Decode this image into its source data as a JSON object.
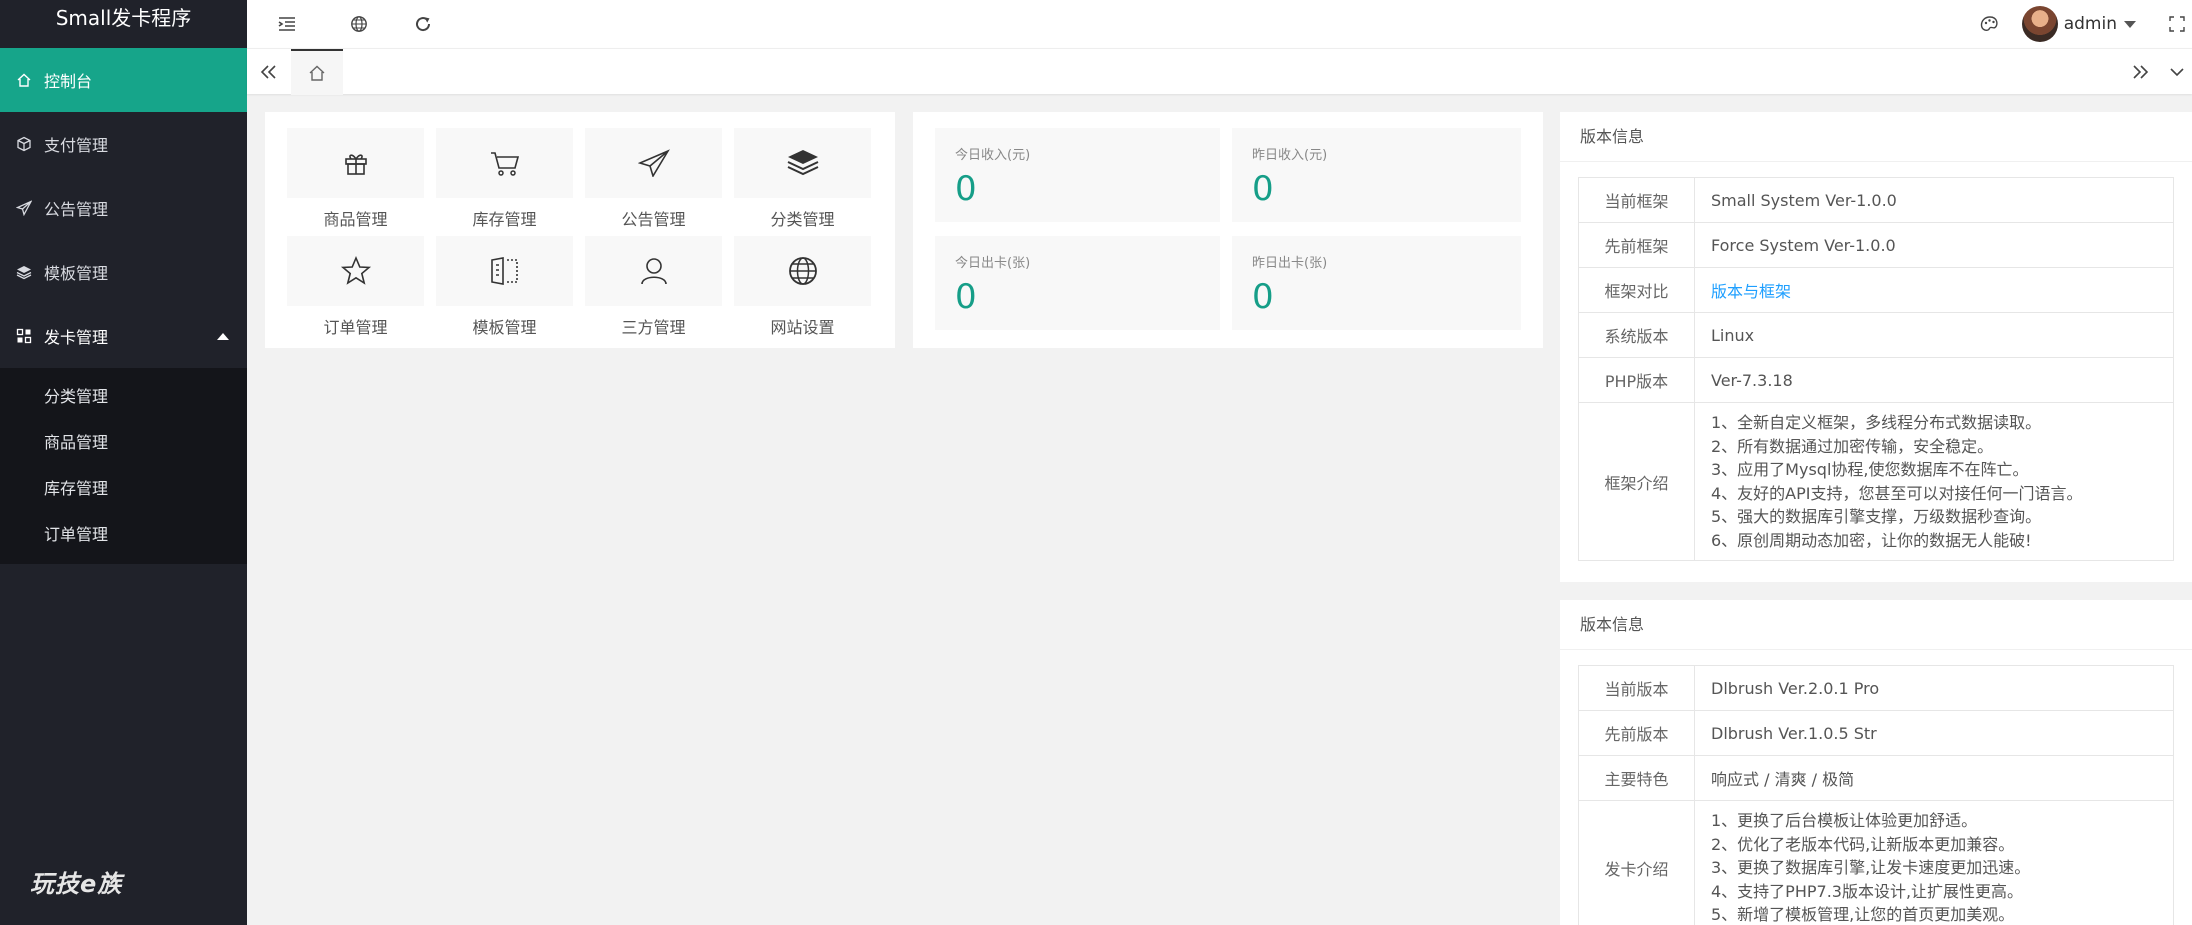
{
  "app": {
    "title": "Small发卡程序"
  },
  "sidebar": {
    "items": [
      {
        "label": "控制台"
      },
      {
        "label": "支付管理"
      },
      {
        "label": "公告管理"
      },
      {
        "label": "模板管理"
      },
      {
        "label": "发卡管理"
      }
    ],
    "subitems": [
      {
        "label": "分类管理"
      },
      {
        "label": "商品管理"
      },
      {
        "label": "库存管理"
      },
      {
        "label": "订单管理"
      }
    ],
    "brand": "玩技e族"
  },
  "header": {
    "user": "admin"
  },
  "quick": [
    {
      "label": "商品管理",
      "icon": "gift-icon"
    },
    {
      "label": "库存管理",
      "icon": "cart-icon"
    },
    {
      "label": "公告管理",
      "icon": "paper-plane-icon"
    },
    {
      "label": "分类管理",
      "icon": "layers-icon"
    },
    {
      "label": "订单管理",
      "icon": "star-icon"
    },
    {
      "label": "模板管理",
      "icon": "template-icon"
    },
    {
      "label": "三方管理",
      "icon": "user-icon"
    },
    {
      "label": "网站设置",
      "icon": "globe-icon"
    }
  ],
  "stats": [
    {
      "label": "今日收入(元)",
      "value": "0"
    },
    {
      "label": "昨日收入(元)",
      "value": "0"
    },
    {
      "label": "今日出卡(张)",
      "value": "0"
    },
    {
      "label": "昨日出卡(张)",
      "value": "0"
    }
  ],
  "info1": {
    "title": "版本信息",
    "rows": [
      {
        "k": "当前框架",
        "v": "Small System Ver-1.0.0"
      },
      {
        "k": "先前框架",
        "v": "Force System Ver-1.0.0"
      },
      {
        "k": "框架对比",
        "v": "版本与框架"
      },
      {
        "k": "系统版本",
        "v": "Linux"
      },
      {
        "k": "PHP版本",
        "v": "Ver-7.3.18"
      }
    ],
    "intro_k": "框架介绍",
    "intro": [
      "1、全新自定义框架，多线程分布式数据读取。",
      "2、所有数据通过加密传输，安全稳定。",
      "3、应用了Mysql协程,使您数据库不在阵亡。",
      "4、友好的API支持，您甚至可以对接任何一门语言。",
      "5、强大的数据库引擎支撑，万级数据秒查询。",
      "6、原创周期动态加密，让你的数据无人能破!"
    ]
  },
  "info2": {
    "title": "版本信息",
    "rows": [
      {
        "k": "当前版本",
        "v": "Dlbrush Ver.2.0.1 Pro"
      },
      {
        "k": "先前版本",
        "v": "Dlbrush Ver.1.0.5 Str"
      },
      {
        "k": "主要特色",
        "v": "响应式 / 清爽 / 极简"
      }
    ],
    "intro_k": "发卡介绍",
    "intro": [
      "1、更换了后台模板让体验更加舒适。",
      "2、优化了老版本代码,让新版本更加兼容。",
      "3、更换了数据库引擎,让发卡速度更加迅速。",
      "4、支持了PHP7.3版本设计,让扩展性更高。",
      "5、新增了模板管理,让您的首页更加美观。"
    ]
  }
}
